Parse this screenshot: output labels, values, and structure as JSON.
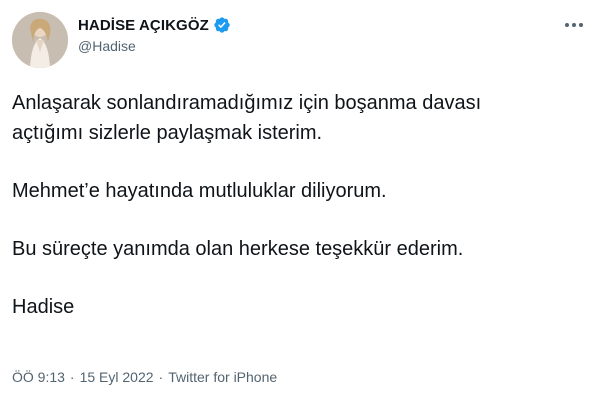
{
  "author": {
    "display_name": "HADİSE AÇIKGÖZ",
    "handle": "@Hadise",
    "verified": true,
    "verified_icon": "verified-badge-icon",
    "accent_color": "#1d9bf0"
  },
  "menu": {
    "icon": "more-options-icon"
  },
  "tweet": {
    "paragraphs": [
      "Anlaşarak sonlandıramadığımız için boşanma davası\naçtığımı sizlerle paylaşmak isterim.",
      "Mehmet’e hayatında mutluluklar diliyorum.",
      "Bu süreçte yanımda olan herkese teşekkür ederim.",
      "Hadise"
    ]
  },
  "meta": {
    "time": "ÖÖ 9:13",
    "separator": "·",
    "date": "15 Eyl 2022",
    "source": "Twitter for iPhone"
  }
}
